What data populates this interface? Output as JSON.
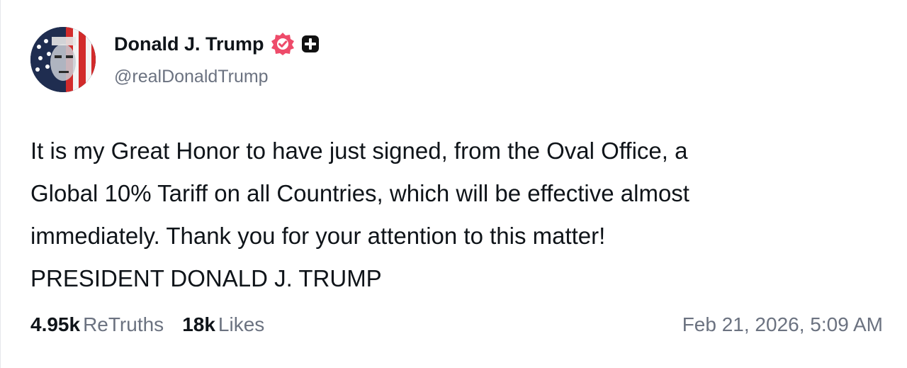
{
  "author": {
    "display_name": "Donald J. Trump",
    "handle": "@realDonaldTrump",
    "verified_badge_icon": "verified-check-icon",
    "verified_badge_color": "#ee4b6a",
    "plus_badge_icon": "plus-square-icon"
  },
  "post": {
    "lines": [
      "It is my Great Honor to have just signed, from the Oval Office, a",
      "Global 10% Tariff on all Countries, which will be effective almost",
      "immediately. Thank you for your attention to this matter!",
      "PRESIDENT DONALD J. TRUMP"
    ]
  },
  "stats": {
    "retruths_count": "4.95k",
    "retruths_label": "ReTruths",
    "likes_count": "18k",
    "likes_label": "Likes"
  },
  "timestamp": "Feb 21, 2026, 5:09 AM",
  "colors": {
    "text": "#0f1419",
    "muted": "#6b7280",
    "badge": "#ee4b6a"
  }
}
